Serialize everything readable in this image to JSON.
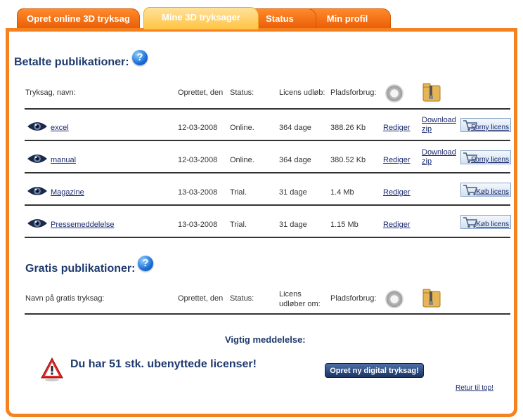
{
  "tabs": [
    {
      "label": "Opret online 3D tryksag"
    },
    {
      "label": "Mine 3D tryksager"
    },
    {
      "label": "Status"
    },
    {
      "label": "Min profil"
    }
  ],
  "paid": {
    "title": "Betalte publikationer:",
    "headers": {
      "name": "Tryksag, navn:",
      "created": "Oprettet, den",
      "status": "Status:",
      "license": "Licens udløb:",
      "space": "Pladsforbrug:"
    },
    "rows": [
      {
        "name": "excel",
        "created": "12-03-2008",
        "status": "Online.",
        "license": "364 dage",
        "space": "388.26 Kb",
        "edit": "Rediger",
        "download": "Download zip",
        "license_btn": "Forny licens"
      },
      {
        "name": "manual",
        "created": "12-03-2008",
        "status": "Online.",
        "license": "364 dage",
        "space": "380.52 Kb",
        "edit": "Rediger",
        "download": "Download zip",
        "license_btn": "Forny licens"
      },
      {
        "name": "Magazine",
        "created": "13-03-2008",
        "status": "Trial.",
        "license": "31 dage",
        "space": "1.4 Mb",
        "edit": "Rediger",
        "download": "",
        "license_btn": "Køb licens"
      },
      {
        "name": "Pressemeddelelse",
        "created": "13-03-2008",
        "status": "Trial.",
        "license": "31 dage",
        "space": "1.15 Mb",
        "edit": "Rediger",
        "download": "",
        "license_btn": "Køb licens"
      }
    ]
  },
  "free": {
    "title": "Gratis publikationer:",
    "headers": {
      "name": "Navn på gratis tryksag:",
      "created": "Oprettet, den",
      "status": "Status:",
      "license": "Licens udløber om:",
      "space": "Pladsforbrug:"
    }
  },
  "notice": {
    "title": "Vigtig meddelelse:",
    "text": "Du har 51 stk. ubenyttede licenser!",
    "button": "Opret ny digital tryksag!",
    "back": "Retur til top!"
  },
  "icons": {
    "help": "?"
  },
  "colors": {
    "accent": "#f58220",
    "heading": "#1e3a6e"
  }
}
